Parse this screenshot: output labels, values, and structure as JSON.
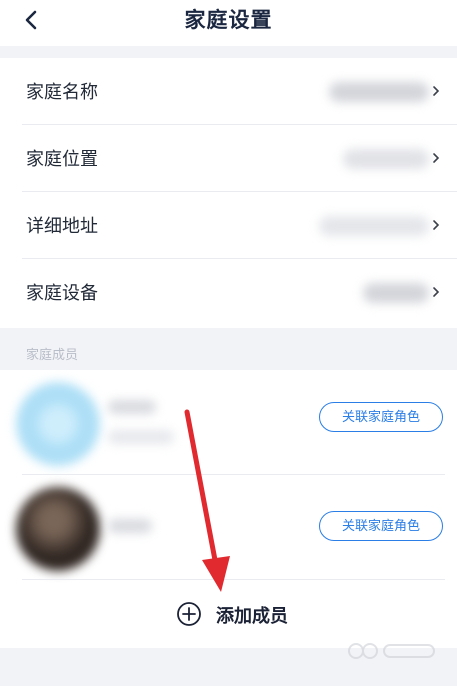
{
  "header": {
    "title": "家庭设置",
    "back_icon": "chevron-left-icon"
  },
  "settings": {
    "items": [
      {
        "label": "家庭名称"
      },
      {
        "label": "家庭位置"
      },
      {
        "label": "详细地址"
      },
      {
        "label": "家庭设备"
      }
    ]
  },
  "members_section": {
    "label": "家庭成员",
    "members": [
      {
        "role_button": "关联家庭角色"
      },
      {
        "role_button": "关联家庭角色"
      }
    ],
    "add_member_label": "添加成员",
    "add_icon": "plus-circle-icon"
  },
  "colors": {
    "accent": "#2a7ee6",
    "annotation": "#e02a2f",
    "title": "#1b2740"
  }
}
